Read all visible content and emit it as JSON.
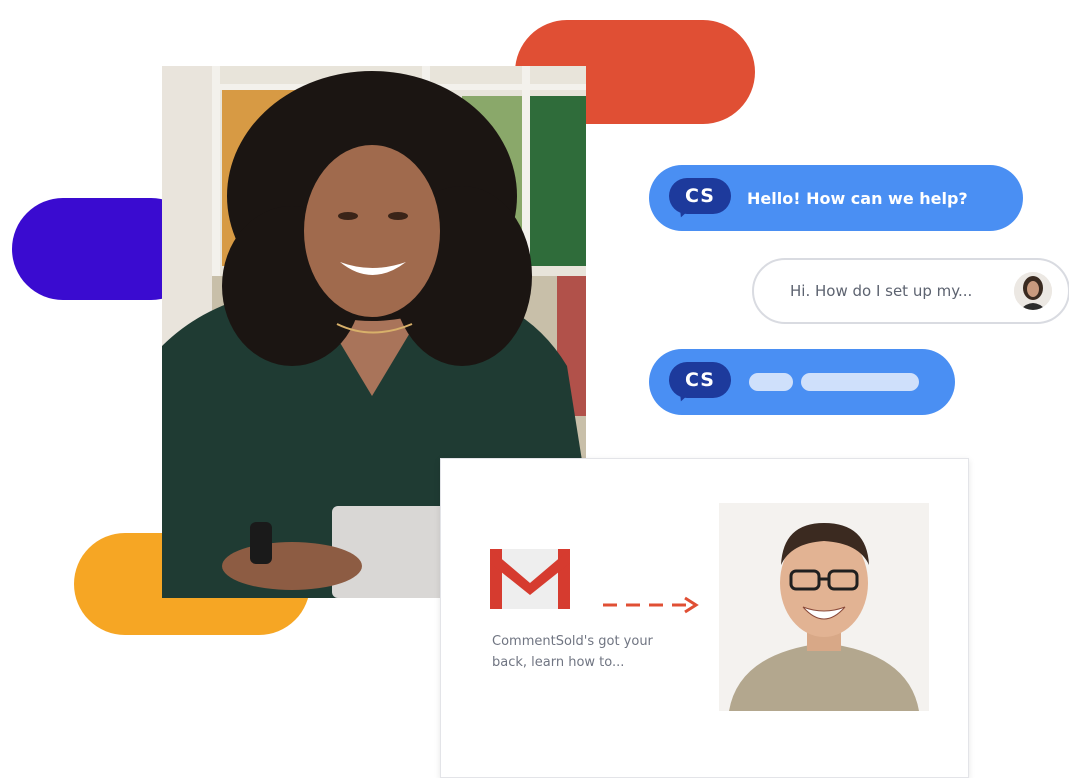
{
  "colors": {
    "red_pill": "#e04f34",
    "purple_pill": "#3a0bd0",
    "yellow_pill": "#f6a624",
    "chat_blue": "#4a8ff3",
    "cs_logo_navy": "#1d3a9c",
    "gmail_red": "#d63b2f"
  },
  "chat": {
    "agent_greeting": "Hello! How can we help?",
    "user_message": "Hi. How do I set up my...",
    "logo_text": "CS",
    "logo_icon": "cs-chat-bubble-icon",
    "user_avatar_icon": "user-avatar-icon"
  },
  "email": {
    "preview_text": "CommentSold's got your back, learn how to...",
    "logo_icon": "gmail-icon",
    "arrow_icon": "dashed-arrow-icon"
  }
}
